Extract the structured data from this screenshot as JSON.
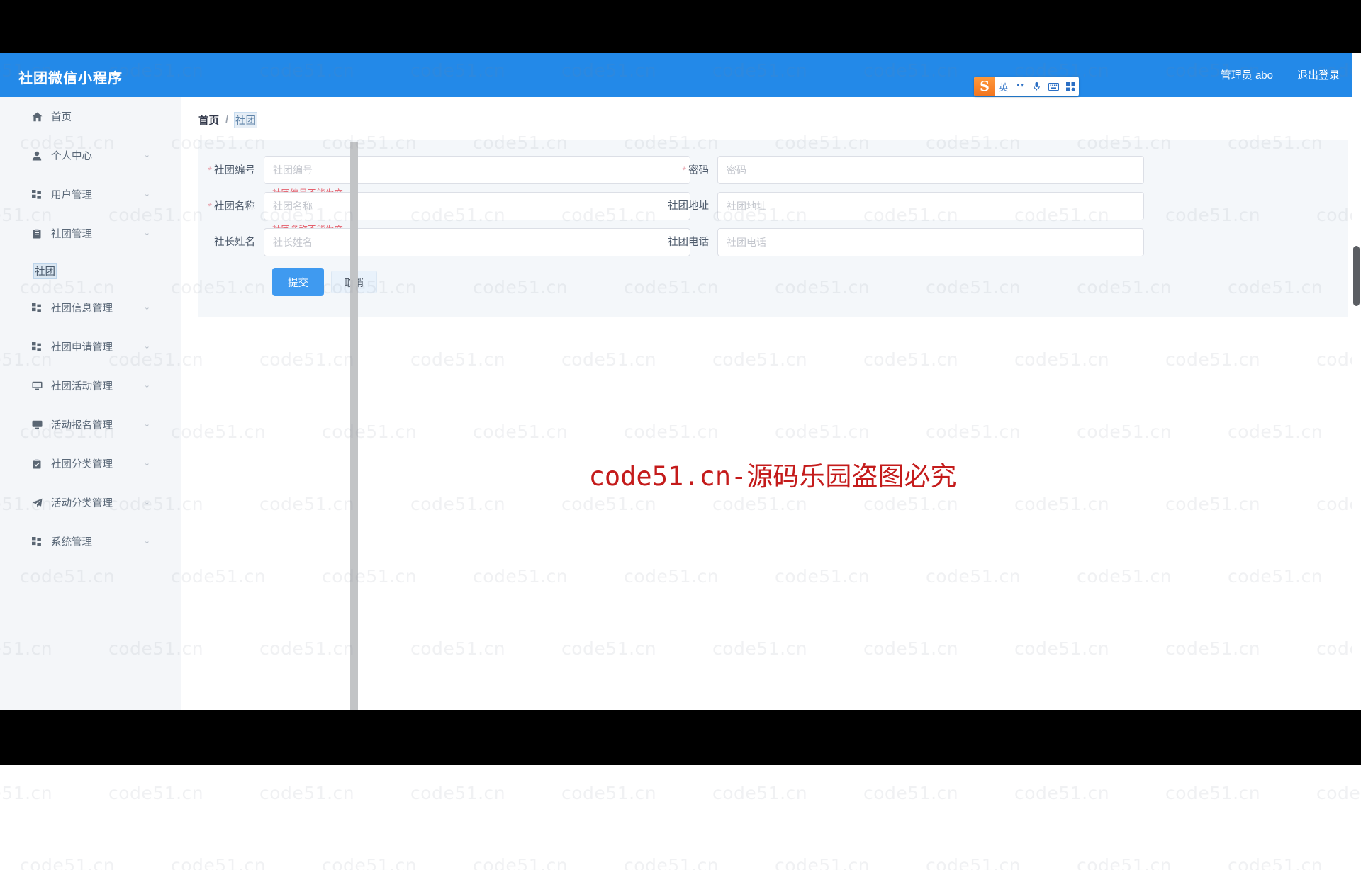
{
  "header": {
    "brand": "社团微信小程序",
    "admin_label": "管理员 abo",
    "logout_label": "退出登录"
  },
  "ime": {
    "logo": "sogou-logo-icon",
    "mode_label": "英",
    "punct_icon": "punctuation-icon",
    "mic_icon": "microphone-icon",
    "keyboard_icon": "keyboard-icon",
    "apps_icon": "apps-grid-icon"
  },
  "sidebar": {
    "items": [
      {
        "label": "首页",
        "icon": "home-icon",
        "arrow": "",
        "type": "link"
      },
      {
        "label": "个人中心",
        "icon": "user-icon",
        "arrow": "⌄",
        "type": "group"
      },
      {
        "label": "用户管理",
        "icon": "grid-icon",
        "arrow": "⌄",
        "type": "group"
      },
      {
        "label": "社团管理",
        "icon": "clipboard-icon",
        "arrow": "⌄",
        "type": "group"
      },
      {
        "label": "社团信息管理",
        "icon": "grid-icon",
        "arrow": "⌄",
        "type": "group"
      },
      {
        "label": "社团申请管理",
        "icon": "grid-icon",
        "arrow": "⌄",
        "type": "group"
      },
      {
        "label": "社团活动管理",
        "icon": "monitor-icon",
        "arrow": "⌄",
        "type": "group"
      },
      {
        "label": "活动报名管理",
        "icon": "monitor-filled-icon",
        "arrow": "⌄",
        "type": "group"
      },
      {
        "label": "社团分类管理",
        "icon": "checklist-icon",
        "arrow": "⌄",
        "type": "group"
      },
      {
        "label": "活动分类管理",
        "icon": "send-icon",
        "arrow": "⌄",
        "type": "group"
      },
      {
        "label": "系统管理",
        "icon": "grid-icon",
        "arrow": "⌄",
        "type": "group"
      }
    ],
    "submenu": {
      "label": "社团",
      "parent_index": 3
    }
  },
  "breadcrumb": {
    "home": "首页",
    "sep": "/",
    "current": "社团"
  },
  "form": {
    "fields": [
      {
        "label": "社团编号",
        "required": true,
        "placeholder": "社团编号",
        "value": "",
        "error": "社团编号不能为空",
        "col": "left",
        "row": 0,
        "type": "text"
      },
      {
        "label": "社团名称",
        "required": true,
        "placeholder": "社团名称",
        "value": "",
        "error": "社团名称不能为空",
        "col": "left",
        "row": 1,
        "type": "text"
      },
      {
        "label": "社长姓名",
        "required": false,
        "placeholder": "社长姓名",
        "value": "",
        "error": "",
        "col": "left",
        "row": 2,
        "type": "text"
      },
      {
        "label": "密码",
        "required": true,
        "placeholder": "密码",
        "value": "",
        "error": "",
        "col": "right",
        "row": 0,
        "type": "password"
      },
      {
        "label": "社团地址",
        "required": false,
        "placeholder": "社团地址",
        "value": "",
        "error": "",
        "col": "right",
        "row": 1,
        "type": "text"
      },
      {
        "label": "社团电话",
        "required": false,
        "placeholder": "社团电话",
        "value": "",
        "error": "",
        "col": "right",
        "row": 2,
        "type": "text"
      }
    ],
    "submit_label": "提交",
    "cancel_label": "取消"
  },
  "watermark": {
    "tile_text": "code51.cn",
    "copyright_text": "code51.cn-源码乐园盗图必究",
    "copyright_color": "#c41b1b",
    "logo": "b-logo-watermark"
  },
  "colors": {
    "header_blue": "#2389e8",
    "primary_blue": "#3f9af0",
    "sidebar_bg": "#f4f6f9",
    "panel_bg": "#f4f7fa",
    "error_red": "#e4606d"
  }
}
